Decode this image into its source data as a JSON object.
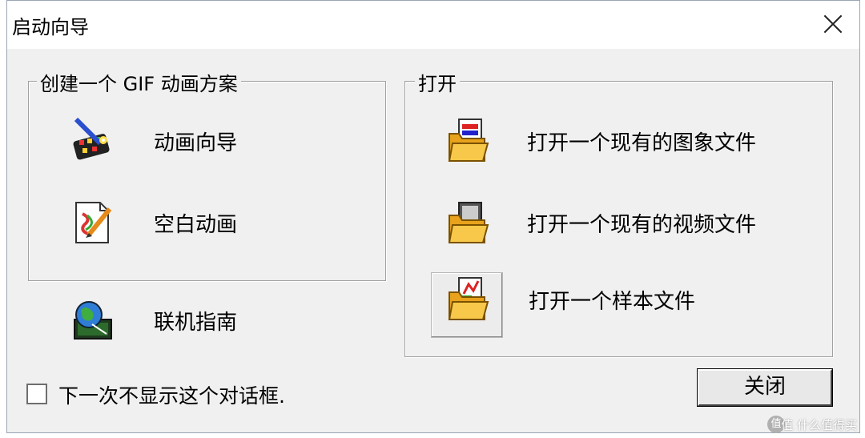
{
  "window": {
    "title": "启动向导"
  },
  "create_group": {
    "title": "创建一个 GIF 动画方案",
    "items": [
      {
        "label": "动画向导",
        "icon": "animation-wizard-icon"
      },
      {
        "label": "空白动画",
        "icon": "blank-animation-icon"
      }
    ]
  },
  "online_help": {
    "label": "联机指南",
    "icon": "online-guide-icon"
  },
  "open_group": {
    "title": "打开",
    "items": [
      {
        "label": "打开一个现有的图象文件",
        "icon": "open-image-folder-icon"
      },
      {
        "label": "打开一个现有的视频文件",
        "icon": "open-video-folder-icon"
      },
      {
        "label": "打开一个样本文件",
        "icon": "open-sample-folder-icon"
      }
    ]
  },
  "dont_show": {
    "label": "下一次不显示这个对话框.",
    "checked": false
  },
  "close_button": {
    "label": "关闭"
  },
  "watermark": {
    "text": "值 什么值得买"
  }
}
